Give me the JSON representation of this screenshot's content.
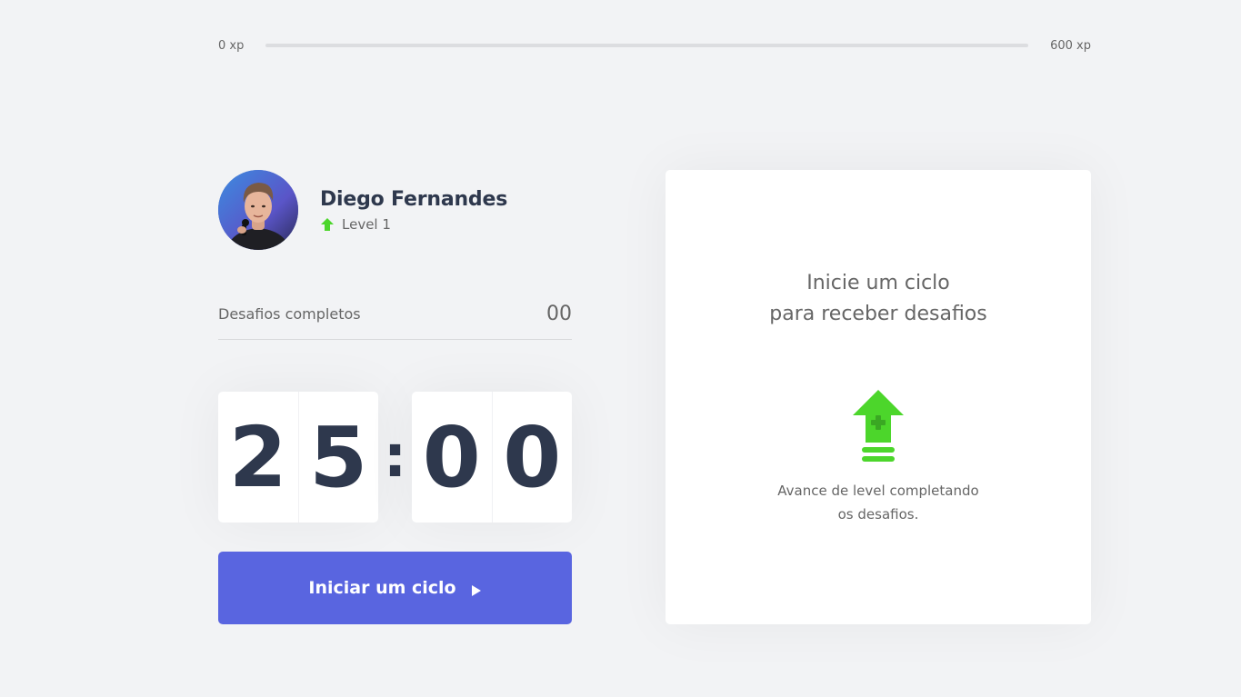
{
  "xp": {
    "min_label": "0 xp",
    "max_label": "600 xp",
    "progress_fraction": 0
  },
  "profile": {
    "name": "Diego Fernandes",
    "level": "Level 1"
  },
  "completed": {
    "label": "Desafios completos",
    "count": "00"
  },
  "countdown": {
    "minute_left": "2",
    "minute_right": "5",
    "separator": ":",
    "second_left": "0",
    "second_right": "0"
  },
  "start_button": {
    "label": "Iniciar um ciclo"
  },
  "challenge": {
    "title_line1": "Inicie um ciclo",
    "title_line2": "para receber desafios",
    "hint_line1": "Avance de level completando",
    "hint_line2": "os desafios."
  },
  "colors": {
    "background": "#f2f3f5",
    "accent_blue": "#5965e0",
    "accent_green": "#4cd62b",
    "text": "#666666",
    "title": "#2e384d",
    "card": "#ffffff"
  },
  "icons": {
    "level": "green-arrow-up-icon",
    "play": "play-icon",
    "challenge": "level-up-icon"
  }
}
